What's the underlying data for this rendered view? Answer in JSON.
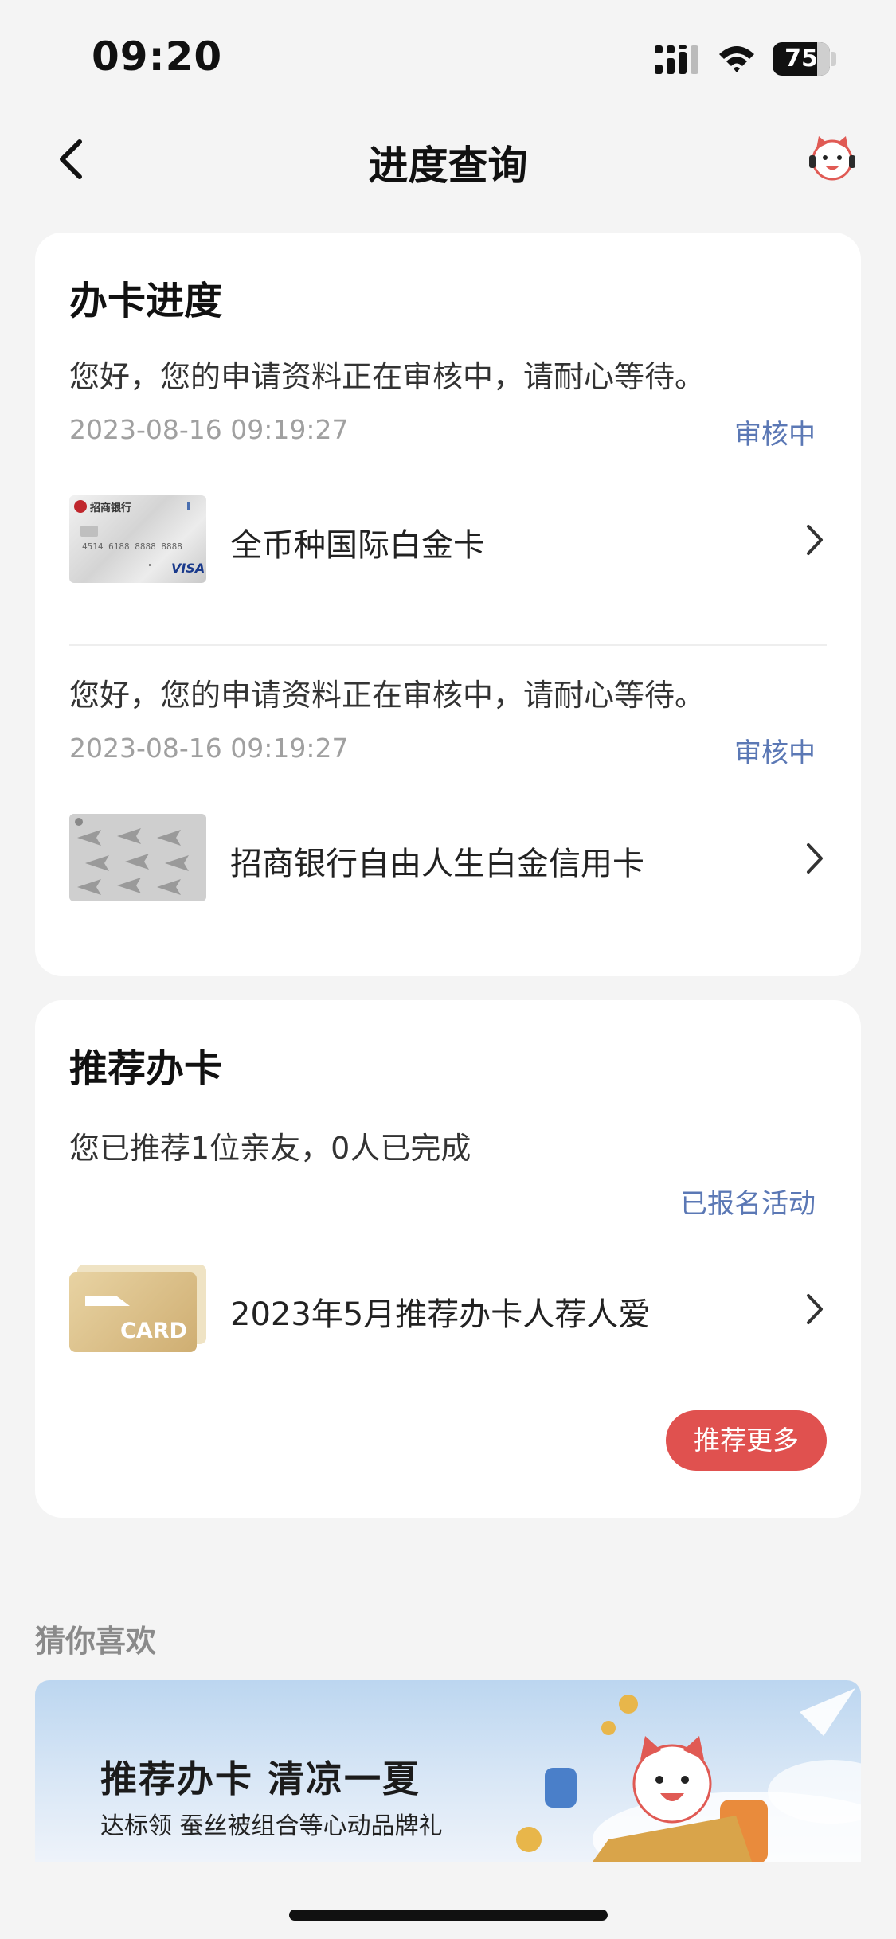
{
  "status_bar": {
    "time": "09:20",
    "battery": "75"
  },
  "nav": {
    "title": "进度查询"
  },
  "progress_card": {
    "title": "办卡进度",
    "applications": [
      {
        "message": "您好，您的申请资料正在审核中，请耐心等待。",
        "timestamp": "2023-08-16 09:19:27",
        "status": "审核中",
        "product": "全币种国际白金卡",
        "card_bank_label": "招商银行",
        "card_number_text": "4514 6188 8888 8888",
        "card_brand": "VISA"
      },
      {
        "message": "您好，您的申请资料正在审核中，请耐心等待。",
        "timestamp": "2023-08-16 09:19:27",
        "status": "审核中",
        "product": "招商银行自由人生白金信用卡"
      }
    ]
  },
  "referral_card": {
    "title": "推荐办卡",
    "summary": "您已推荐1位亲友，0人已完成",
    "status": "已报名活动",
    "item_label": "2023年5月推荐办卡人荐人爱",
    "card_icon_text": "CARD",
    "more_button": "推荐更多"
  },
  "recommend_section": {
    "label": "猜你喜欢"
  },
  "banner": {
    "title": "推荐办卡 清凉一夏",
    "subtitle": "达标领 蚕丝被组合等心动品牌礼"
  },
  "colors": {
    "accent_red": "#e0514f",
    "status_blue": "#5b78b5",
    "background": "#f4f4f4"
  }
}
